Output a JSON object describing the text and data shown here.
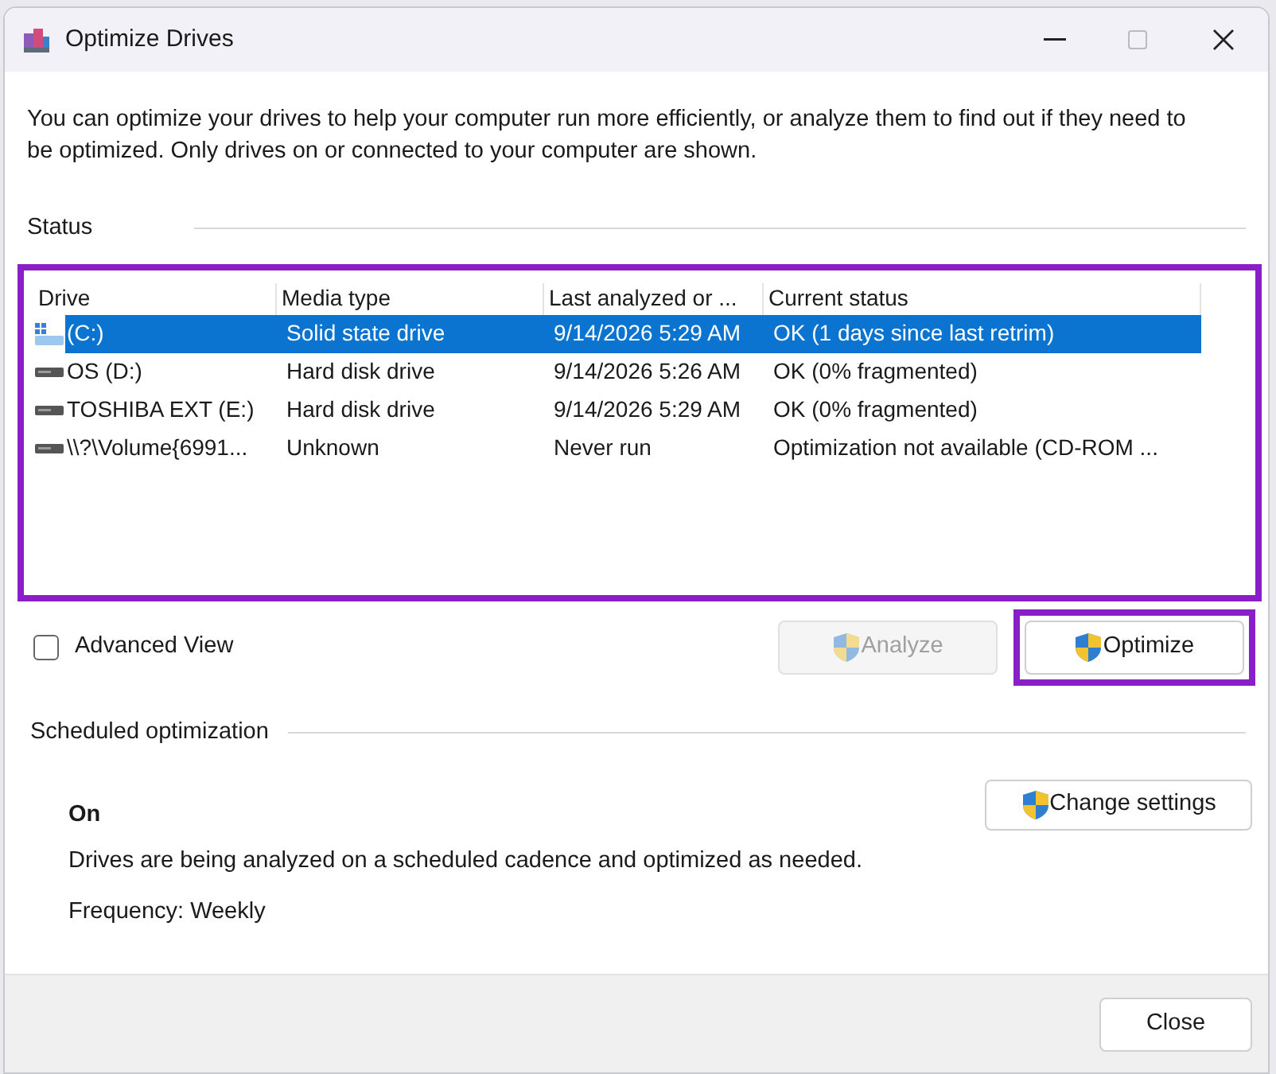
{
  "window": {
    "title": "Optimize Drives"
  },
  "description": "You can optimize your drives to help your computer run more efficiently, or analyze them to find out if they need to be optimized. Only drives on or connected to your computer are shown.",
  "status": {
    "label": "Status",
    "columns": [
      "Drive",
      "Media type",
      "Last analyzed or ...",
      "Current status"
    ],
    "rows": [
      {
        "kind": "system",
        "selected": true,
        "cells": [
          "(C:)",
          "Solid state drive",
          "9/14/2026 5:29 AM",
          "OK (1 days since last retrim)"
        ]
      },
      {
        "kind": "disk",
        "selected": false,
        "cells": [
          "OS (D:)",
          "Hard disk drive",
          "9/14/2026 5:26 AM",
          "OK (0% fragmented)"
        ]
      },
      {
        "kind": "disk",
        "selected": false,
        "cells": [
          "TOSHIBA EXT (E:)",
          "Hard disk drive",
          "9/14/2026 5:29 AM",
          "OK (0% fragmented)"
        ]
      },
      {
        "kind": "disk",
        "selected": false,
        "cells": [
          "\\\\?\\Volume{6991...",
          "Unknown",
          "Never run",
          "Optimization not available (CD-ROM ..."
        ]
      }
    ]
  },
  "advanced_view": {
    "label": "Advanced View",
    "checked": false
  },
  "buttons": [
    {
      "label": "Analyze",
      "disabled": true
    },
    {
      "label": "Optimize",
      "disabled": false
    }
  ],
  "scheduled": {
    "label": "Scheduled optimization",
    "state": "On",
    "description": "Drives are being analyzed on a scheduled cadence and optimized as needed.",
    "frequency": "Frequency: Weekly",
    "button": "Change settings"
  },
  "footer": {
    "close": "Close"
  }
}
